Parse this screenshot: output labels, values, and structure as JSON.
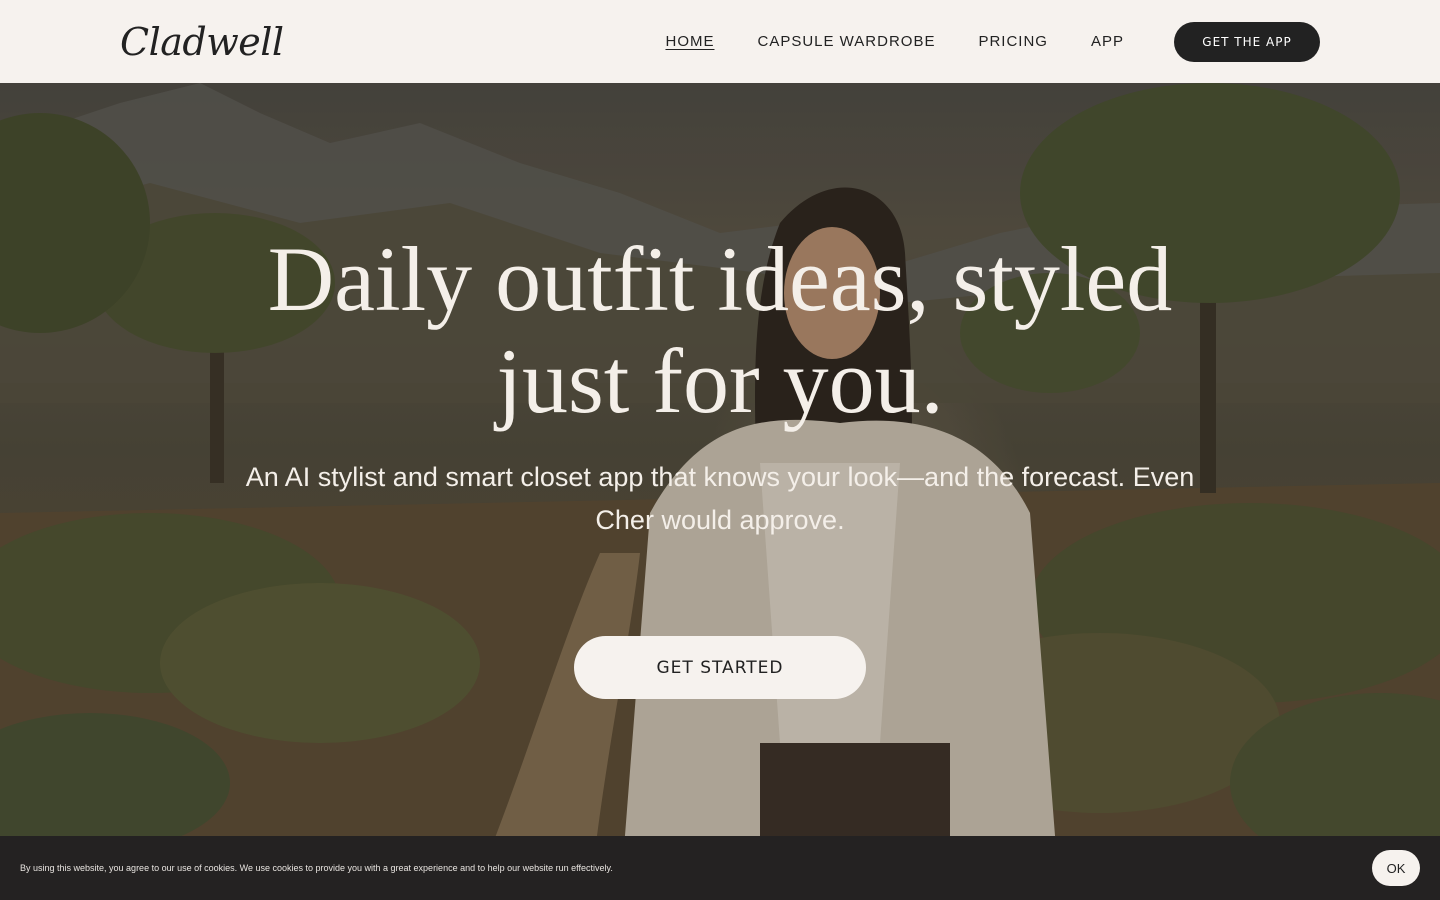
{
  "header": {
    "logo_text": "Cladwell",
    "nav": [
      {
        "label": "HOME",
        "active": true
      },
      {
        "label": "CAPSULE WARDROBE",
        "active": false
      },
      {
        "label": "PRICING",
        "active": false
      },
      {
        "label": "APP",
        "active": false
      }
    ],
    "cta_label": "GET THE APP"
  },
  "hero": {
    "title_line1": "Daily outfit ideas, styled",
    "title_line2": "just for you.",
    "subtitle": "An AI stylist and smart closet app that knows your look—and the forecast. Even Cher would approve.",
    "cta_label": "GET STARTED"
  },
  "cookie_bar": {
    "text": "By using this website, you agree to our use of cookies. We use cookies to provide you with a great experience and to help our website run effectively.",
    "ok_label": "OK"
  },
  "colors": {
    "header_bg": "#f6f2ee",
    "dark": "#222222",
    "hero_text": "#f4efe9",
    "cookie_bg": "#242222"
  }
}
